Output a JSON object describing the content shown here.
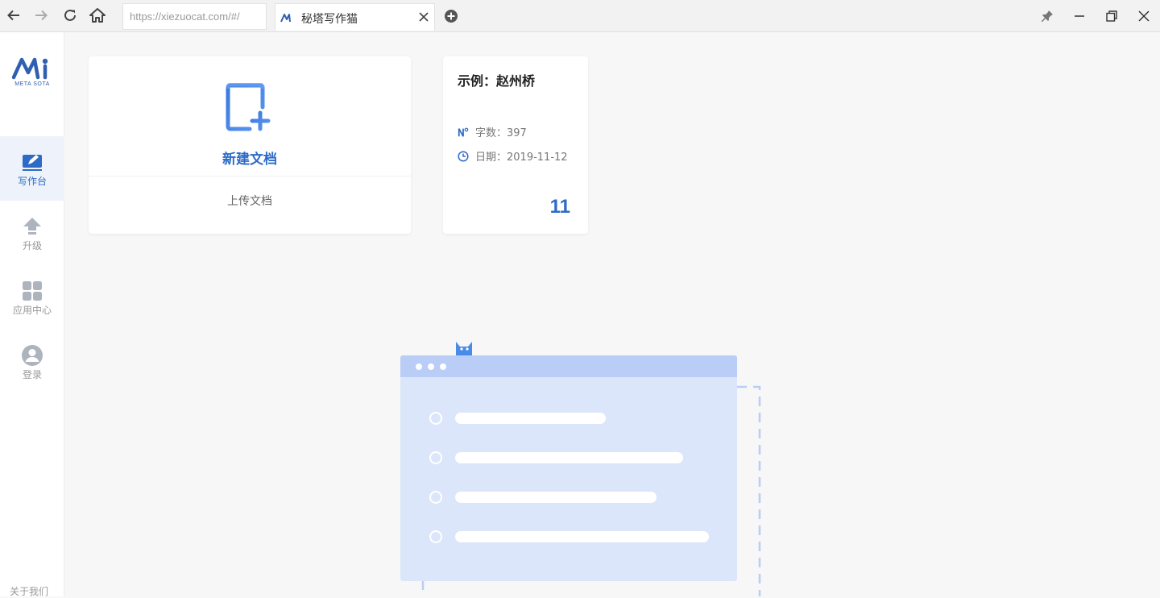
{
  "browser": {
    "url": "https://xiezuocat.com/#/",
    "tab_title": "秘塔写作猫"
  },
  "sidebar": {
    "logo_text": "META SOTA",
    "items": [
      {
        "label": "写作台",
        "icon": "pen-icon",
        "active": true
      },
      {
        "label": "升级",
        "icon": "upload-arrow-icon"
      },
      {
        "label": "应用中心",
        "icon": "apps-grid-icon"
      },
      {
        "label": "登录",
        "icon": "user-icon"
      }
    ],
    "about": "关于我们"
  },
  "main": {
    "new_doc_label": "新建文档",
    "upload_label": "上传文档",
    "example": {
      "title": "示例：赵州桥",
      "word_count_label": "字数：397",
      "date_label": "日期：2019-11-12",
      "count": "11"
    }
  },
  "colors": {
    "accent": "#2e6bc6",
    "illustration_fill": "#dbe6fb",
    "illustration_header": "#b9cdf7"
  }
}
